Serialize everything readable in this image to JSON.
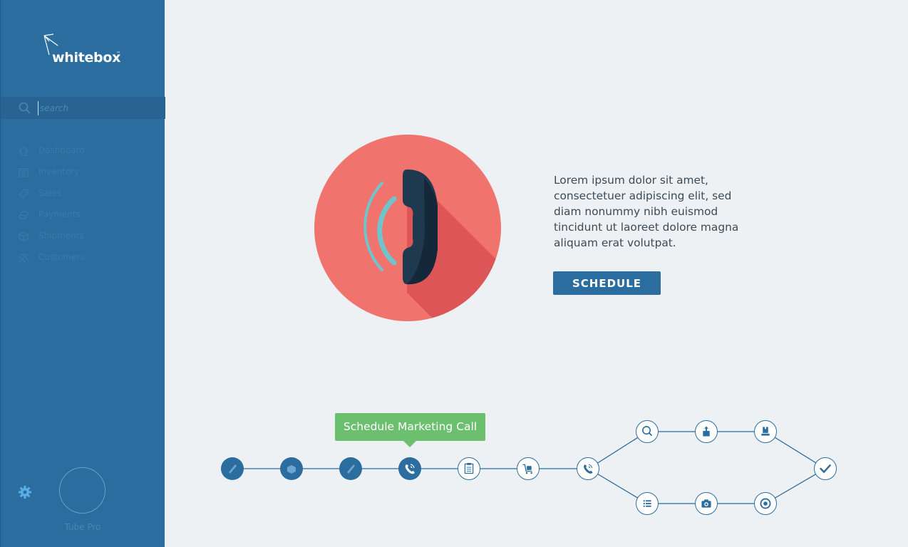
{
  "brand": {
    "logo_text": "whitebox",
    "logo_tm": "™"
  },
  "search": {
    "placeholder": "search",
    "value": ""
  },
  "sidebar": {
    "items": [
      {
        "label": "Dashboard",
        "icon": "home-icon"
      },
      {
        "label": "Inventory",
        "icon": "calendar-icon"
      },
      {
        "label": "Sales",
        "icon": "tag-icon"
      },
      {
        "label": "Payments",
        "icon": "coins-icon"
      },
      {
        "label": "Shipments",
        "icon": "box-icon"
      },
      {
        "label": "Customers",
        "icon": "users-icon"
      }
    ],
    "user_name": "Tube Pro",
    "settings_icon": "gear-icon"
  },
  "main": {
    "description": "Lorem ipsum dolor sit amet, consectetuer adipiscing elit, sed diam nonummy nibh euismod tincidunt ut laoreet dolore magna aliquam erat volutpat.",
    "schedule_label": "SCHEDULE",
    "hero_icon": "phone-icon",
    "tooltip": "Schedule Marketing Call"
  },
  "colors": {
    "sidebar": "#2a6d9e",
    "background": "#edf1f4",
    "hero": "#f0736e",
    "tooltip": "#6cbf6f",
    "accent": "#2a6d9e"
  },
  "workflow": {
    "steps": [
      {
        "icon": "pencil-icon",
        "state": "done"
      },
      {
        "icon": "box-icon",
        "state": "done"
      },
      {
        "icon": "pencil-icon",
        "state": "done"
      },
      {
        "icon": "phone-icon",
        "state": "current"
      },
      {
        "icon": "clipboard-icon",
        "state": "pending"
      },
      {
        "icon": "cart-icon",
        "state": "pending"
      },
      {
        "icon": "phone-icon",
        "state": "pending"
      },
      {
        "icon": "search-icon",
        "state": "pending"
      },
      {
        "icon": "upload-icon",
        "state": "pending"
      },
      {
        "icon": "package-icon",
        "state": "pending"
      },
      {
        "icon": "list-icon",
        "state": "pending"
      },
      {
        "icon": "camera-icon",
        "state": "pending"
      },
      {
        "icon": "target-icon",
        "state": "pending"
      },
      {
        "icon": "check-icon",
        "state": "pending"
      }
    ]
  }
}
